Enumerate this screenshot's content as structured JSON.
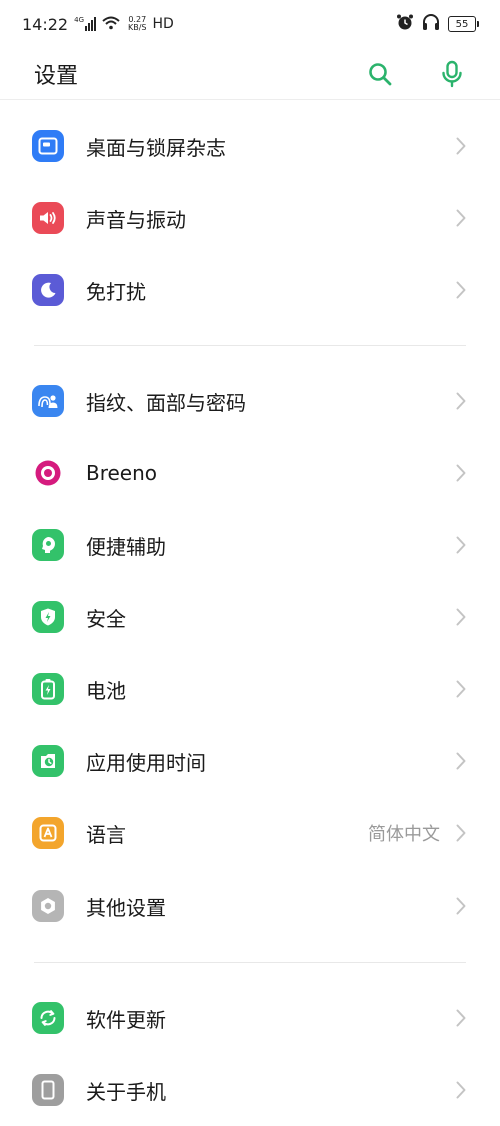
{
  "status_bar": {
    "time": "14:22",
    "network": "4G",
    "speed_value": "0.27",
    "speed_unit": "KB/S",
    "hd": "HD",
    "battery": "55"
  },
  "header": {
    "title": "设置"
  },
  "colors": {
    "accent": "#2bb36c",
    "wallpaper": "#2f7cf6",
    "sound": "#ea4a57",
    "dnd": "#5b5bd6",
    "fingerprint": "#3a86f0",
    "breeno": "#d51b7e",
    "green": "#33c26a",
    "language": "#f3a52c",
    "other": "#9e9e9e"
  },
  "items": [
    {
      "label": "桌面与锁屏杂志",
      "icon": "wallpaper-icon"
    },
    {
      "label": "声音与振动",
      "icon": "speaker-icon"
    },
    {
      "label": "免打扰",
      "icon": "moon-icon"
    },
    {
      "label": "指纹、面部与密码",
      "icon": "fingerprint-face-icon"
    },
    {
      "label": "Breeno",
      "icon": "breeno-icon"
    },
    {
      "label": "便捷辅助",
      "icon": "assist-icon"
    },
    {
      "label": "安全",
      "icon": "shield-icon"
    },
    {
      "label": "电池",
      "icon": "battery-icon"
    },
    {
      "label": "应用使用时间",
      "icon": "app-usage-icon"
    },
    {
      "label": "语言",
      "value": "简体中文",
      "icon": "language-icon"
    },
    {
      "label": "其他设置",
      "icon": "gear-icon"
    },
    {
      "label": "软件更新",
      "icon": "update-icon"
    },
    {
      "label": "关于手机",
      "icon": "phone-icon"
    }
  ]
}
